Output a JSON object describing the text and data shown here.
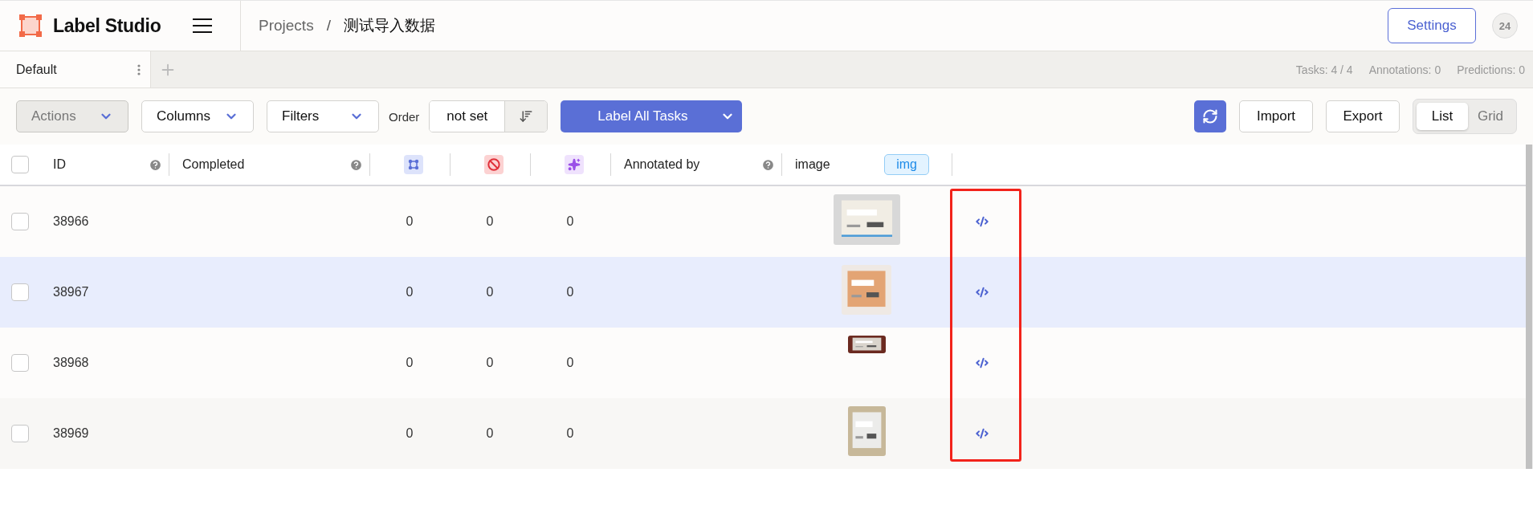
{
  "app": {
    "name": "Label Studio"
  },
  "breadcrumb": {
    "parent": "Projects",
    "separator": "/",
    "current": "测试导入数据"
  },
  "settings_button": "Settings",
  "user_avatar": "24",
  "tabs": [
    {
      "label": "Default",
      "selected": true
    }
  ],
  "stats": [
    "Tasks: 4 / 4",
    "Annotations: 0",
    "Predictions: 0"
  ],
  "toolbar": {
    "actions": {
      "label": "Actions",
      "disabled": true
    },
    "columns": "Columns",
    "filters": "Filters",
    "order_label": "Order",
    "order_value": "not set",
    "label_all": "Label All Tasks",
    "import": "Import",
    "export": "Export",
    "view_modes": [
      {
        "label": "List",
        "selected": true
      },
      {
        "label": "Grid",
        "selected": false
      }
    ]
  },
  "table": {
    "select_all_checked": false,
    "id_header": "ID",
    "completed_header": "Completed",
    "annotated_header": "Annotated by",
    "image_header": "image",
    "image_type": "img",
    "rows": [
      {
        "id": "38966",
        "checked": false,
        "counts": [
          "0",
          "0",
          "0"
        ],
        "highlighted": false,
        "image": {
          "kind": "picture"
        }
      },
      {
        "id": "38967",
        "checked": false,
        "counts": [
          "0",
          "0",
          "0"
        ],
        "highlighted": true,
        "image": {
          "kind": "picture"
        }
      },
      {
        "id": "38968",
        "checked": false,
        "counts": [
          "0",
          "0",
          "0"
        ],
        "highlighted": false,
        "image": {
          "kind": "picture"
        }
      },
      {
        "id": "38969",
        "checked": false,
        "counts": [
          "0",
          "0",
          "0"
        ],
        "highlighted": false,
        "image": {
          "kind": "picture"
        }
      }
    ]
  }
}
